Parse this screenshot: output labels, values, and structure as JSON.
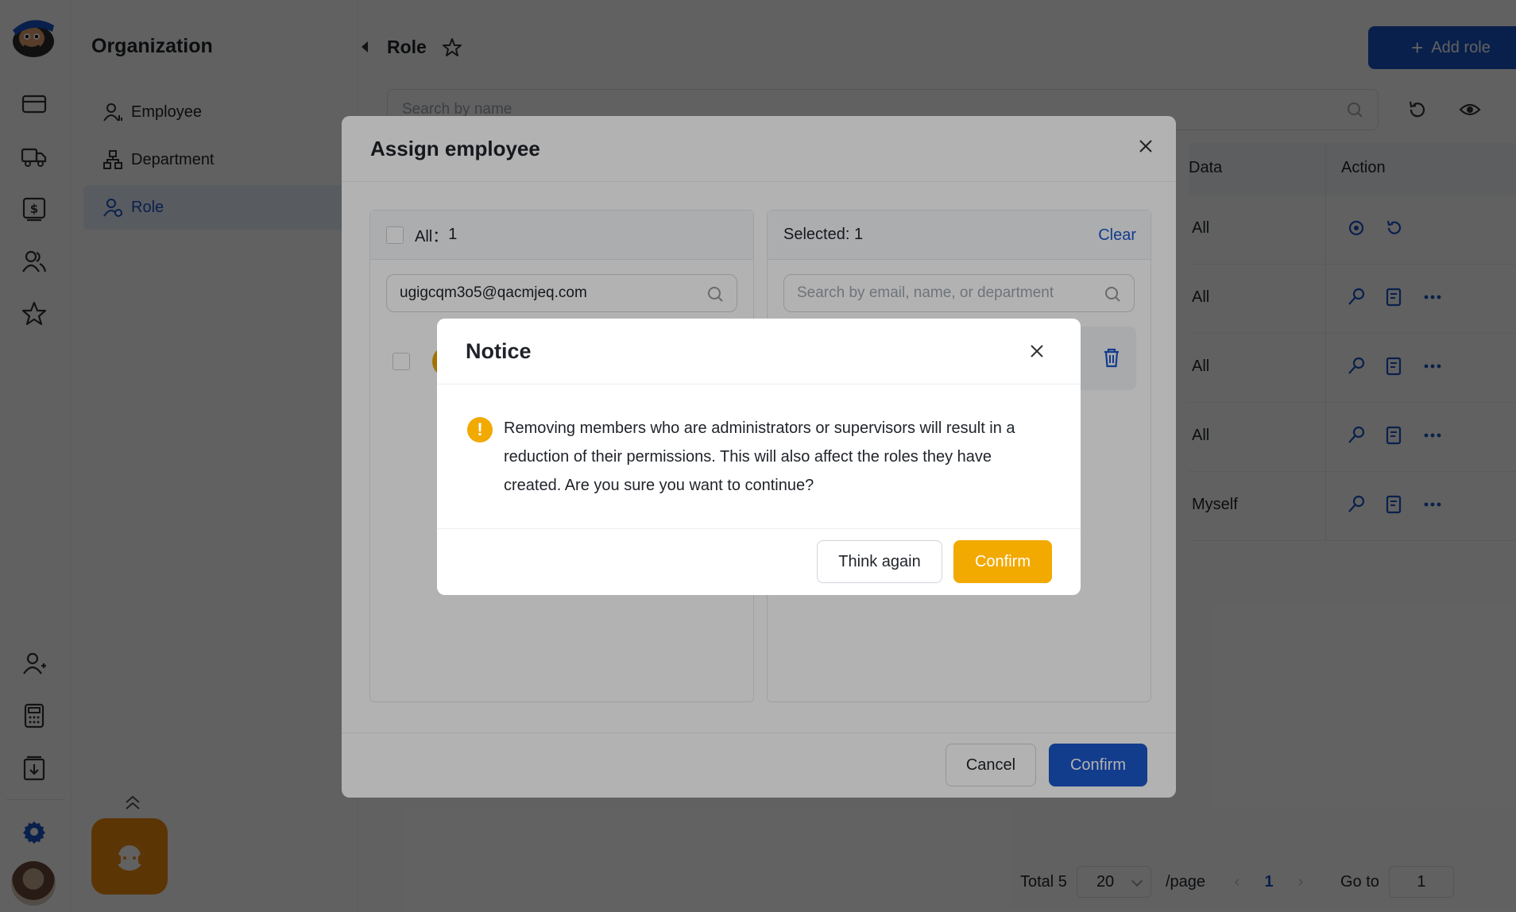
{
  "rail": {
    "icons": [
      "logo-mascot",
      "card-icon",
      "truck-icon",
      "dollar-icon",
      "users-icon",
      "star-icon",
      "user-add-icon",
      "calculator-icon",
      "download-icon",
      "settings-icon"
    ]
  },
  "sidebar": {
    "title": "Organization",
    "items": [
      {
        "label": "Employee",
        "icon": "employee-icon"
      },
      {
        "label": "Department",
        "icon": "department-icon"
      },
      {
        "label": "Role",
        "icon": "role-icon",
        "active": true
      }
    ]
  },
  "main": {
    "title": "Role",
    "add_role_label": "Add role",
    "search_placeholder": "Search by name",
    "table": {
      "headers": {
        "data": "Data",
        "action": "Action"
      },
      "rows": [
        {
          "data": "All"
        },
        {
          "data": "All"
        },
        {
          "data": "All"
        },
        {
          "data": "All"
        },
        {
          "data": "Myself"
        }
      ]
    },
    "pagination": {
      "total": "Total 5",
      "page_size": "20",
      "per_page": "/page",
      "current": "1",
      "goto_label": "Go to",
      "goto_value": "1"
    }
  },
  "assign_modal": {
    "title": "Assign employee",
    "left": {
      "all_label": "All：",
      "all_count": "1",
      "search_value": "ugigcqm3o5@qacmjeq.com"
    },
    "right": {
      "selected_label": "Selected: 1",
      "clear_label": "Clear",
      "search_placeholder": "Search by email, name, or department"
    },
    "cancel_label": "Cancel",
    "confirm_label": "Confirm"
  },
  "notice_modal": {
    "title": "Notice",
    "message": "Removing members who are administrators or supervisors will result in a reduction of their permissions. This will also affect the roles they have created. Are you sure you want to continue?",
    "think_again_label": "Think again",
    "confirm_label": "Confirm"
  },
  "colors": {
    "primary": "#1a56c9",
    "warning": "#f2a900",
    "support": "#f08a10"
  }
}
